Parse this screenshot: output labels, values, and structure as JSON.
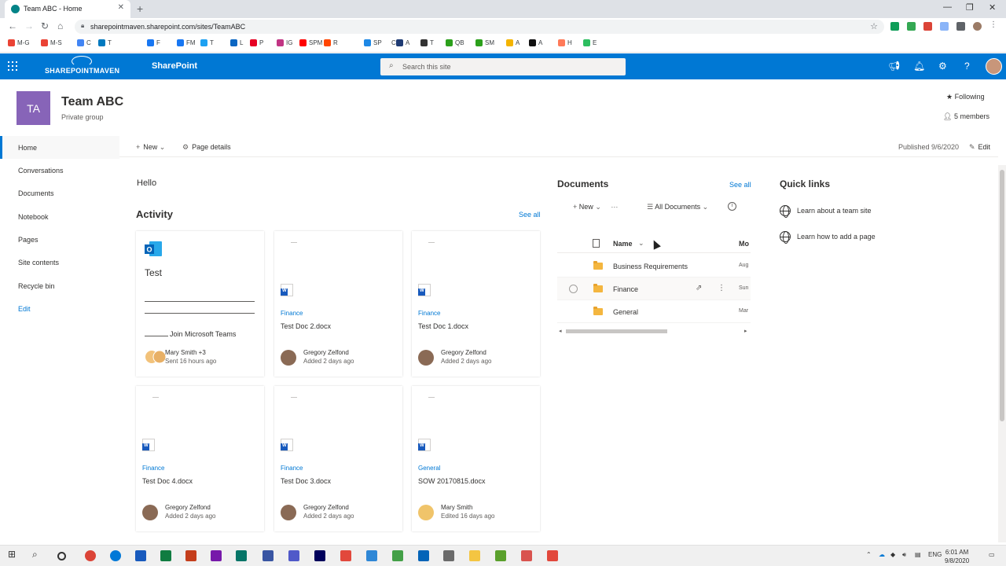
{
  "browser": {
    "tab_title": "Team ABC - Home",
    "url": "sharepointmaven.sharepoint.com/sites/TeamABC",
    "bookmarks": [
      {
        "label": "M-G",
        "color": "#ea4335"
      },
      {
        "label": "M-S",
        "color": "#ea4335"
      },
      {
        "label": "C",
        "color": "#4285f4"
      },
      {
        "label": "T",
        "color": "#0079bf"
      },
      {
        "label": "F",
        "color": "#1877f2"
      },
      {
        "label": "FM",
        "color": "#1877f2"
      },
      {
        "label": "T",
        "color": "#1da1f2"
      },
      {
        "label": "L",
        "color": "#0a66c2"
      },
      {
        "label": "P",
        "color": "#e60023"
      },
      {
        "label": "IG",
        "color": "#c13584"
      },
      {
        "label": "SPM",
        "color": "#ff0000"
      },
      {
        "label": "R",
        "color": "#ff4500"
      },
      {
        "label": "SPM",
        "color": "#1e88e5"
      },
      {
        "label": "C",
        "color": "#ffffff"
      },
      {
        "label": "A",
        "color": "#1f3b73"
      },
      {
        "label": "T",
        "color": "#333333"
      },
      {
        "label": "QB",
        "color": "#2ca01c"
      },
      {
        "label": "SM",
        "color": "#2ca01c"
      },
      {
        "label": "A",
        "color": "#f4b400"
      },
      {
        "label": "A",
        "color": "#111111"
      },
      {
        "label": "H",
        "color": "#ff7a59"
      },
      {
        "label": "E",
        "color": "#2dbe60"
      }
    ]
  },
  "suite": {
    "brand_logo_text": "SHAREPOINTMAVEN",
    "app_name": "SharePoint",
    "search_placeholder": "Search this site"
  },
  "site": {
    "logo_initials": "TA",
    "title": "Team ABC",
    "subtitle": "Private group",
    "following_label": "Following",
    "members_label": "5 members"
  },
  "nav": {
    "items": [
      "Home",
      "Conversations",
      "Documents",
      "Notebook",
      "Pages",
      "Site contents",
      "Recycle bin"
    ],
    "edit_label": "Edit"
  },
  "command_bar": {
    "new_label": "New",
    "page_details_label": "Page details",
    "published_label": "Published 9/6/2020",
    "edit_label": "Edit"
  },
  "content": {
    "hello": "Hello",
    "activity": {
      "title": "Activity",
      "see_all": "See all",
      "test_card": {
        "title": "Test",
        "join_text": "Join Microsoft Teams",
        "person": "Mary Smith +3",
        "meta": "Sent 16 hours ago"
      },
      "cards": [
        {
          "category": "Finance",
          "file": "Test Doc 2.docx",
          "person": "Gregory Zelfond",
          "meta": "Added 2 days ago"
        },
        {
          "category": "Finance",
          "file": "Test Doc 1.docx",
          "person": "Gregory Zelfond",
          "meta": "Added 2 days ago"
        },
        {
          "category": "Finance",
          "file": "Test Doc 4.docx",
          "person": "Gregory Zelfond",
          "meta": "Added 2 days ago"
        },
        {
          "category": "Finance",
          "file": "Test Doc 3.docx",
          "person": "Gregory Zelfond",
          "meta": "Added 2 days ago"
        },
        {
          "category": "General",
          "file": "SOW 20170815.docx",
          "person": "Mary Smith",
          "meta": "Edited 16 days ago"
        }
      ]
    },
    "documents": {
      "title": "Documents",
      "see_all": "See all",
      "new_label": "New",
      "view_label": "All Documents",
      "col_name": "Name",
      "col_modified": "Mo",
      "rows": [
        {
          "name": "Business Requirements",
          "modified": "Aug"
        },
        {
          "name": "Finance",
          "modified": "Sun"
        },
        {
          "name": "General",
          "modified": "Mar"
        }
      ]
    },
    "quick_links": {
      "title": "Quick links",
      "links": [
        "Learn about a team site",
        "Learn how to add a page"
      ]
    }
  },
  "taskbar": {
    "language": "ENG",
    "time": "6:01 AM",
    "date": "9/8/2020"
  }
}
